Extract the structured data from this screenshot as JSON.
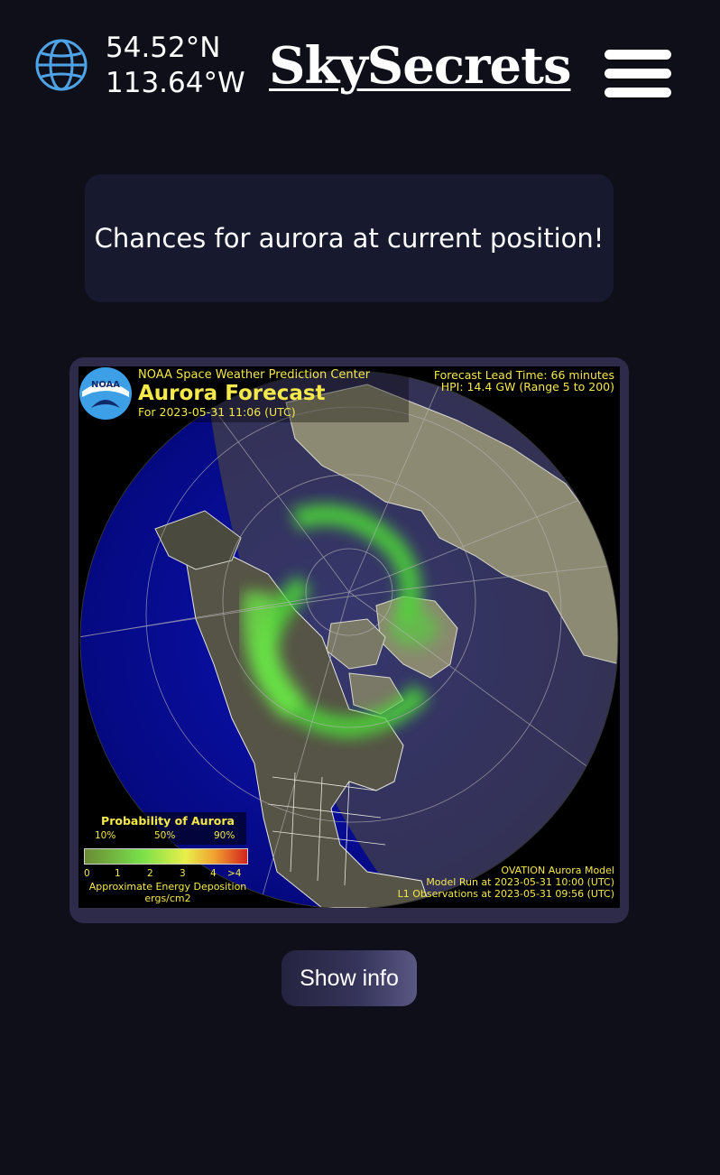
{
  "header": {
    "latitude": "54.52°N",
    "longitude": "113.64°W",
    "logo": "SkySecrets",
    "globe_icon": "globe-icon",
    "menu_icon": "hamburger-menu-icon"
  },
  "banner": {
    "text": "Chances for aurora at current position!"
  },
  "forecast_image": {
    "logo_text": "NOAA",
    "agency": "NOAA Space Weather Prediction Center",
    "title": "Aurora Forecast",
    "date": "For 2023-05-31 11:06 (UTC)",
    "lead_time": "Forecast Lead Time:  66 minutes",
    "hpi": "HPI:  14.4 GW (Range 5 to 200)",
    "legend": {
      "title": "Probability of Aurora",
      "percent_labels": [
        "10%",
        "50%",
        "90%"
      ],
      "energy_labels": [
        "0",
        "1",
        "2",
        "3",
        "4",
        ">4"
      ],
      "energy_caption": "Approximate Energy Deposition",
      "units": "ergs/cm2"
    },
    "model": "OVATION Aurora Model",
    "model_run": "Model Run at 2023-05-31 10:00 (UTC)",
    "l1_observations": "L1 Observations at 2023-05-31 09:56 (UTC)"
  },
  "buttons": {
    "show_info": "Show info"
  },
  "colors": {
    "background": "#0f0f1a",
    "banner": "#171a2e",
    "card": "#2d2b49",
    "map_text": "#f4e84a",
    "globe_icon": "#4ea3e6",
    "ocean": "#0a0fa8",
    "aurora": "#5ce03a"
  }
}
